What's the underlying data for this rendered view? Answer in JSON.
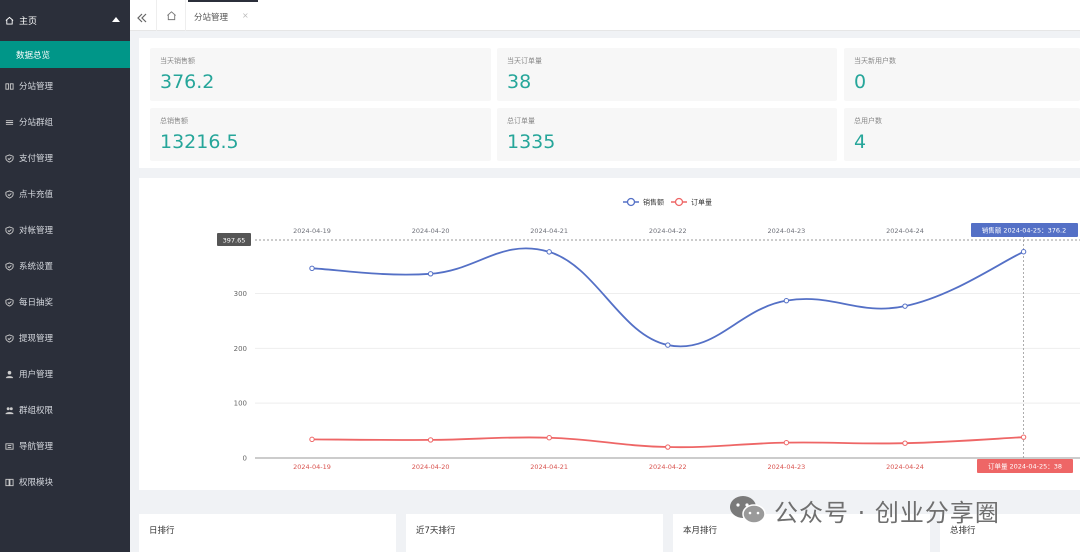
{
  "sidebar": {
    "header": "主页",
    "active_item": "数据总览",
    "items": [
      {
        "label": "分站管理",
        "icon": "grid-icon"
      },
      {
        "label": "分站群组",
        "icon": "sliders-icon"
      },
      {
        "label": "支付管理",
        "icon": "shield-icon"
      },
      {
        "label": "点卡充值",
        "icon": "shield-icon"
      },
      {
        "label": "对帐管理",
        "icon": "shield-icon"
      },
      {
        "label": "系统设置",
        "icon": "shield-icon"
      },
      {
        "label": "每日抽奖",
        "icon": "shield-icon"
      },
      {
        "label": "提现管理",
        "icon": "shield-icon"
      },
      {
        "label": "用户管理",
        "icon": "user-icon"
      },
      {
        "label": "群组权限",
        "icon": "users-icon"
      },
      {
        "label": "导航管理",
        "icon": "nav-icon"
      },
      {
        "label": "权限模块",
        "icon": "module-icon"
      }
    ]
  },
  "tabs": {
    "current": "分站管理",
    "close": "×"
  },
  "stats": [
    {
      "label": "当天销售额",
      "value": "376.2"
    },
    {
      "label": "当天订单量",
      "value": "38"
    },
    {
      "label": "当天新用户数",
      "value": "0"
    },
    {
      "label": "总销售额",
      "value": "13216.5"
    },
    {
      "label": "总订单量",
      "value": "1335"
    },
    {
      "label": "总用户数",
      "value": "4"
    }
  ],
  "chart_data": {
    "type": "line",
    "x": [
      "2024-04-19",
      "2024-04-20",
      "2024-04-21",
      "2024-04-22",
      "2024-04-23",
      "2024-04-24",
      "2024-04-25"
    ],
    "series": [
      {
        "name": "销售额",
        "values": [
          346,
          336,
          376,
          206,
          287,
          277,
          376.2
        ],
        "color": "#5470c6"
      },
      {
        "name": "订单量",
        "values": [
          34,
          33,
          37,
          20,
          28,
          27,
          38
        ],
        "color": "#ee6666"
      }
    ],
    "ylim": [
      0,
      397.65
    ],
    "yticks": [
      0,
      100,
      200,
      300
    ],
    "grid": true,
    "legend": "top-center",
    "axis_pointer_value": "397.65",
    "tooltip_top": "销售额  2024-04-25：376.2",
    "tooltip_bottom": "订单量  2024-04-25：38"
  },
  "rankings": [
    "日排行",
    "近7天排行",
    "本月排行",
    "总排行"
  ],
  "watermark": "公众号 · 创业分享圈"
}
